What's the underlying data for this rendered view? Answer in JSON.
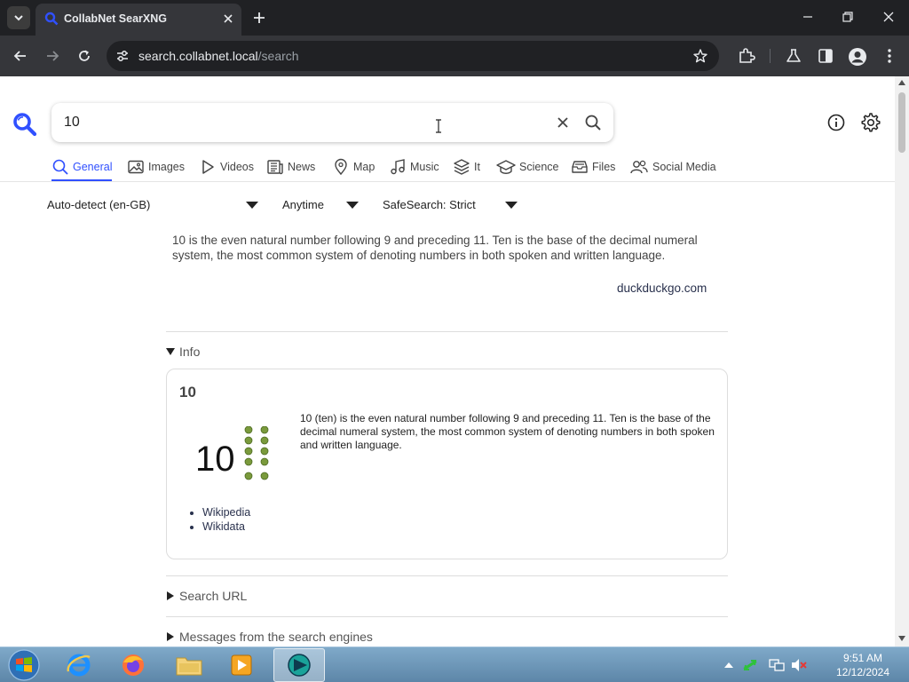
{
  "browser": {
    "tab_title": "CollabNet SearXNG",
    "url_host": "search.collabnet.local",
    "url_path": "/search"
  },
  "search": {
    "query": "10"
  },
  "categories": [
    {
      "label": "General",
      "icon": "search-icon",
      "active": true
    },
    {
      "label": "Images",
      "icon": "image-icon"
    },
    {
      "label": "Videos",
      "icon": "play-icon"
    },
    {
      "label": "News",
      "icon": "newspaper-icon"
    },
    {
      "label": "Map",
      "icon": "map-pin-icon"
    },
    {
      "label": "Music",
      "icon": "music-icon"
    },
    {
      "label": "It",
      "icon": "layers-icon"
    },
    {
      "label": "Science",
      "icon": "school-icon"
    },
    {
      "label": "Files",
      "icon": "file-tray-icon"
    },
    {
      "label": "Social Media",
      "icon": "people-icon"
    }
  ],
  "filters": {
    "language": "Auto-detect (en-GB)",
    "time": "Anytime",
    "safesearch": "SafeSearch: Strict"
  },
  "answer": {
    "text": "10 is the even natural number following 9 and preceding 11. Ten is the base of the decimal numeral system, the most common system of denoting numbers in both spoken and written language.",
    "source": "duckduckgo.com"
  },
  "infobox": {
    "summary": "Info",
    "title": "10",
    "image_number": "10",
    "text": "10 (ten) is the even natural number following 9 and preceding 11. Ten is the base of the decimal numeral system, the most common system of denoting numbers in both spoken and written language.",
    "links": [
      "Wikipedia",
      "Wikidata"
    ]
  },
  "sections": {
    "search_url": "Search URL",
    "messages": "Messages from the search engines"
  },
  "taskbar": {
    "time": "9:51 AM",
    "date": "12/12/2024"
  },
  "colors": {
    "accent": "#3050ff",
    "link": "#29314d",
    "titlebar": "#202124",
    "toolbar": "#35363a"
  }
}
